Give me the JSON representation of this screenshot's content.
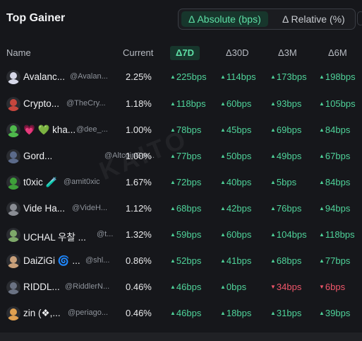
{
  "title": "Top Gainer",
  "toggle": {
    "absolute_label": "Δ Absolute (bps)",
    "relative_label": "Δ Relative (%)",
    "selected": "absolute"
  },
  "columns": {
    "name": "Name",
    "current": "Current",
    "d7": "Δ7D",
    "d30": "Δ30D",
    "d3m": "Δ3M",
    "d6m": "Δ6M"
  },
  "watermark": "KAITO",
  "colors": {
    "up": "#4fd39a",
    "down": "#f0566a",
    "accent_bg": "#17362c"
  },
  "rows": [
    {
      "name": "Avalanc...",
      "handle": "@Avalan...",
      "current": "2.25%",
      "d7": "225bps",
      "d7_dir": "up",
      "d30": "114bps",
      "d30_dir": "up",
      "d3m": "173bps",
      "d3m_dir": "up",
      "d6m": "198bps",
      "d6m_dir": "up",
      "avatar_color": "#d6d8e8"
    },
    {
      "name": "Crypto...",
      "handle": "@TheCry...",
      "current": "1.18%",
      "d7": "118bps",
      "d7_dir": "up",
      "d30": "60bps",
      "d30_dir": "up",
      "d3m": "93bps",
      "d3m_dir": "up",
      "d6m": "105bps",
      "d6m_dir": "up",
      "avatar_color": "#c7463d"
    },
    {
      "name": "💗 💚 kha...",
      "handle": "@dee_...",
      "current": "1.00%",
      "d7": "78bps",
      "d7_dir": "up",
      "d30": "45bps",
      "d30_dir": "up",
      "d3m": "69bps",
      "d3m_dir": "up",
      "d6m": "84bps",
      "d6m_dir": "up",
      "avatar_color": "#4fb94c"
    },
    {
      "name": "Gord...",
      "handle": "@AltcoinGor...",
      "current": "1.00%",
      "d7": "77bps",
      "d7_dir": "up",
      "d30": "50bps",
      "d30_dir": "up",
      "d3m": "49bps",
      "d3m_dir": "up",
      "d6m": "67bps",
      "d6m_dir": "up",
      "avatar_color": "#5b6a8a"
    },
    {
      "name": "t0xic 🧪",
      "handle": "@amit0xic",
      "current": "1.67%",
      "d7": "72bps",
      "d7_dir": "up",
      "d30": "40bps",
      "d30_dir": "up",
      "d3m": "5bps",
      "d3m_dir": "up",
      "d6m": "84bps",
      "d6m_dir": "up",
      "avatar_color": "#3fa03a"
    },
    {
      "name": "Vide Ha...",
      "handle": "@VideH...",
      "current": "1.12%",
      "d7": "68bps",
      "d7_dir": "up",
      "d30": "42bps",
      "d30_dir": "up",
      "d3m": "76bps",
      "d3m_dir": "up",
      "d6m": "94bps",
      "d6m_dir": "up",
      "avatar_color": "#8a8d94"
    },
    {
      "name": "UCHAL 우찰 ...",
      "handle": "@t...",
      "current": "1.32%",
      "d7": "59bps",
      "d7_dir": "up",
      "d30": "60bps",
      "d30_dir": "up",
      "d3m": "104bps",
      "d3m_dir": "up",
      "d6m": "118bps",
      "d6m_dir": "up",
      "avatar_color": "#7ea86a"
    },
    {
      "name": "DaiZiGi 🌀 ...",
      "handle": "@shl...",
      "current": "0.86%",
      "d7": "52bps",
      "d7_dir": "up",
      "d30": "41bps",
      "d30_dir": "up",
      "d3m": "68bps",
      "d3m_dir": "up",
      "d6m": "77bps",
      "d6m_dir": "up",
      "avatar_color": "#c9a07a"
    },
    {
      "name": "RIDDL...",
      "handle": "@RiddlerN...",
      "current": "0.46%",
      "d7": "46bps",
      "d7_dir": "up",
      "d30": "0bps",
      "d30_dir": "up",
      "d3m": "34bps",
      "d3m_dir": "down",
      "d6m": "6bps",
      "d6m_dir": "down",
      "avatar_color": "#6a7283"
    },
    {
      "name": "zin (❖,...",
      "handle": "@periago...",
      "current": "0.46%",
      "d7": "46bps",
      "d7_dir": "up",
      "d30": "18bps",
      "d30_dir": "up",
      "d3m": "31bps",
      "d3m_dir": "up",
      "d6m": "39bps",
      "d6m_dir": "up",
      "avatar_color": "#e0a050"
    }
  ]
}
